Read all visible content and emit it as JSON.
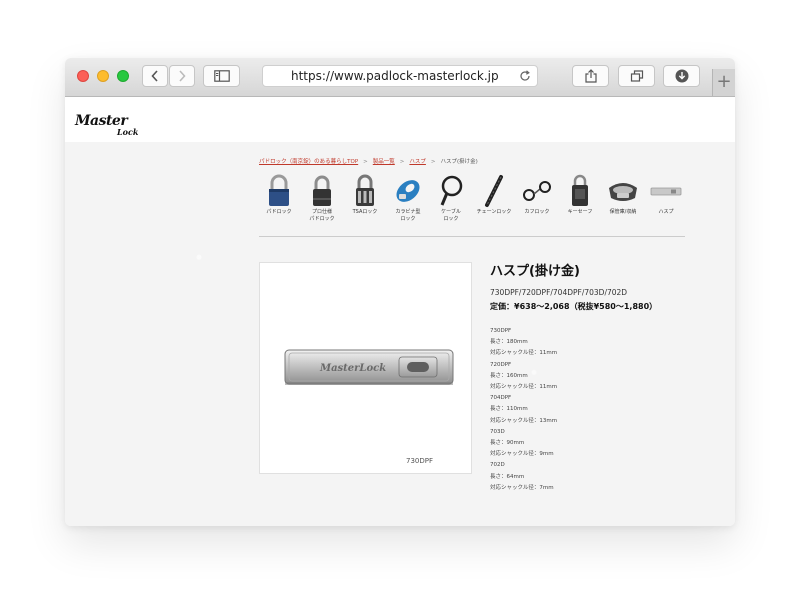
{
  "browser": {
    "url": "https://www.padlock-masterlock.jp",
    "new_tab_label": "+"
  },
  "site": {
    "logo_main": "Master",
    "logo_sub": "Lock"
  },
  "breadcrumb": {
    "items": [
      "パドロック（南京錠）のある暮らしTOP",
      "製品一覧",
      "ハスプ",
      "ハスプ(掛け金)"
    ],
    "separator": ">"
  },
  "categories": [
    {
      "label": "パドロック",
      "icon": "padlock-icon"
    },
    {
      "label": "プロ仕様\nパドロック",
      "icon": "pro-padlock-icon"
    },
    {
      "label": "TSAロック",
      "icon": "tsa-lock-icon"
    },
    {
      "label": "カラビナ型\nロック",
      "icon": "carabiner-lock-icon"
    },
    {
      "label": "ケーブル\nロック",
      "icon": "cable-lock-icon"
    },
    {
      "label": "チェーンロック",
      "icon": "chain-lock-icon"
    },
    {
      "label": "カフロック",
      "icon": "cuff-lock-icon"
    },
    {
      "label": "キーセーフ",
      "icon": "key-safe-icon"
    },
    {
      "label": "保管庫/収納",
      "icon": "storage-icon"
    },
    {
      "label": "ハスプ",
      "icon": "hasp-icon"
    }
  ],
  "product": {
    "title": "ハスプ(掛け金)",
    "models": "730DPF/720DPF/704DPF/703D/702D",
    "price": "定価：¥638〜2,068（税抜¥580〜1,880）",
    "image_caption": "730DPF",
    "image_brand": "MasterLock",
    "specs": [
      "730DPF",
      "長さ：180mm",
      "対応シャックル径：11mm",
      "720DPF",
      "長さ：160mm",
      "対応シャックル径：11mm",
      "704DPF",
      "長さ：110mm",
      "対応シャックル径：13mm",
      "703D",
      "長さ：90mm",
      "対応シャックル径：9mm",
      "702D",
      "長さ：64mm",
      "対応シャックル径：7mm"
    ]
  },
  "colors": {
    "link": "#c0392b",
    "close": "#fc5f57",
    "minimize": "#fdbc2e",
    "maximize": "#28c840",
    "carabiner_blue": "#2a7fc1"
  }
}
